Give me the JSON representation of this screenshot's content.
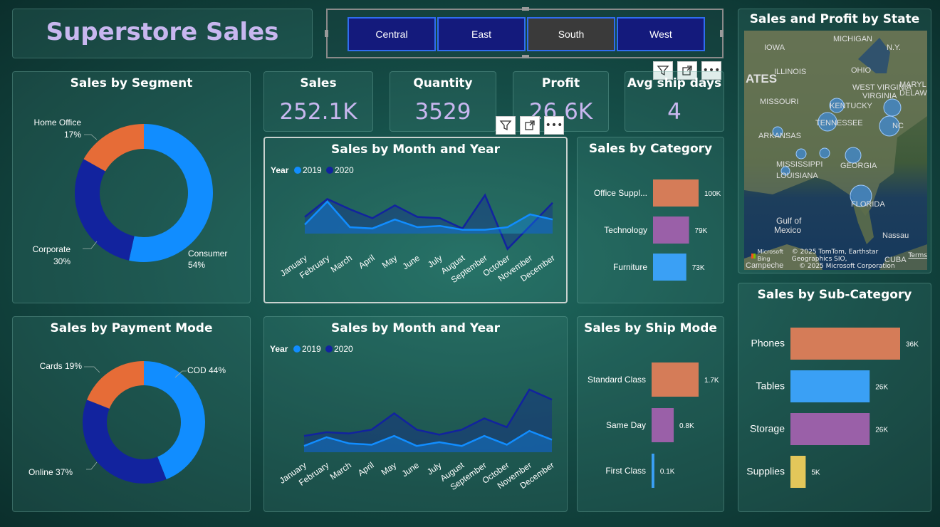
{
  "header": {
    "title": "Superstore Sales"
  },
  "region_slicer": {
    "items": [
      {
        "label": "Central",
        "selected": false
      },
      {
        "label": "East",
        "selected": false
      },
      {
        "label": "South",
        "selected": true
      },
      {
        "label": "West",
        "selected": false
      }
    ]
  },
  "kpis": [
    {
      "title": "Sales",
      "value": "252.1K"
    },
    {
      "title": "Quantity",
      "value": "3529"
    },
    {
      "title": "Profit",
      "value": "26.6K"
    },
    {
      "title": "Avg ship days",
      "value": "4"
    }
  ],
  "segment_chart": {
    "title": "Sales by Segment",
    "slices": [
      {
        "name": "Consumer",
        "pct": 54,
        "label_name": "Consumer",
        "label_pct": "54%",
        "color": "#118dff"
      },
      {
        "name": "Corporate",
        "pct": 30,
        "label_name": "Corporate",
        "label_pct": "30%",
        "color": "#12239e"
      },
      {
        "name": "Home Office",
        "pct": 17,
        "label_name": "Home Office",
        "label_pct": "17%",
        "color": "#e66c37"
      }
    ]
  },
  "payment_chart": {
    "title": "Sales by Payment Mode",
    "slices": [
      {
        "name": "COD",
        "pct": 44,
        "label": "COD 44%",
        "color": "#118dff"
      },
      {
        "name": "Online",
        "pct": 37,
        "label": "Online 37%",
        "color": "#12239e"
      },
      {
        "name": "Cards",
        "pct": 19,
        "label": "Cards 19%",
        "color": "#e66c37"
      }
    ]
  },
  "month_chart_1": {
    "title": "Sales by Month and Year",
    "legend_title": "Year",
    "series": [
      {
        "name": "2019",
        "color": "#118dff",
        "values": [
          7,
          25,
          5,
          4,
          11,
          5,
          6,
          3,
          3,
          5,
          15,
          11
        ]
      },
      {
        "name": "2020",
        "color": "#12239e",
        "values": [
          13,
          27,
          19,
          12,
          22,
          13,
          12,
          4,
          30,
          -12,
          6,
          24
        ]
      }
    ],
    "months": [
      "January",
      "February",
      "March",
      "April",
      "May",
      "June",
      "July",
      "August",
      "September",
      "October",
      "November",
      "December"
    ]
  },
  "month_chart_2": {
    "title": "Sales by Month and Year",
    "legend_title": "Year",
    "series": [
      {
        "name": "2019",
        "color": "#118dff",
        "values": [
          5,
          12,
          7,
          6,
          13,
          5,
          8,
          5,
          13,
          6,
          17,
          10
        ]
      },
      {
        "name": "2020",
        "color": "#12239e",
        "values": [
          13,
          16,
          15,
          18,
          31,
          18,
          14,
          18,
          27,
          20,
          50,
          42
        ]
      }
    ],
    "months": [
      "January",
      "February",
      "March",
      "April",
      "May",
      "June",
      "July",
      "August",
      "September",
      "October",
      "November",
      "December"
    ]
  },
  "category_chart": {
    "title": "Sales by Category",
    "bars": [
      {
        "label": "Office Suppl...",
        "value": 100,
        "value_label": "100K",
        "color": "#d57c58"
      },
      {
        "label": "Technology",
        "value": 79,
        "value_label": "79K",
        "color": "#9a60a8"
      },
      {
        "label": "Furniture",
        "value": 73,
        "value_label": "73K",
        "color": "#3aa0f5"
      }
    ]
  },
  "shipmode_chart": {
    "title": "Sales by Ship Mode",
    "bars": [
      {
        "label": "Standard Class",
        "value": 1.7,
        "value_label": "1.7K",
        "color": "#d57c58"
      },
      {
        "label": "Same Day",
        "value": 0.8,
        "value_label": "0.8K",
        "color": "#9a60a8"
      },
      {
        "label": "First Class",
        "value": 0.1,
        "value_label": "0.1K",
        "color": "#3aa0f5"
      }
    ]
  },
  "subcategory_chart": {
    "title": "Sales by Sub-Category",
    "bars": [
      {
        "label": "Phones",
        "value": 36,
        "value_label": "36K",
        "color": "#d57c58"
      },
      {
        "label": "Tables",
        "value": 26,
        "value_label": "26K",
        "color": "#3aa0f5"
      },
      {
        "label": "Storage",
        "value": 26,
        "value_label": "26K",
        "color": "#9a60a8"
      },
      {
        "label": "Supplies",
        "value": 5,
        "value_label": "5K",
        "color": "#e3c75a"
      }
    ]
  },
  "map": {
    "title": "Sales and Profit by State",
    "labels": [
      "IOWA",
      "MICHIGAN",
      "N.Y.",
      "ILLINOIS",
      "OHIO",
      "ATES",
      "MISSOURI",
      "KENTUCKY",
      "WEST VIRGINIA",
      "VIRGINIA",
      "DELAW",
      "MARYL",
      "TENNESSEE",
      "NC",
      "ARKANSAS",
      "MISSISSIPPI",
      "GEORGIA",
      "LOUISIANA",
      "FLORIDA",
      "Gulf of",
      "Mexico",
      "Nassau",
      "CUBA",
      "Campeche"
    ],
    "copyright_1": "© 2025 TomTom, Earthstar Geographics SIO,",
    "copyright_2": "© 2025 Microsoft Corporation",
    "terms": "Terms",
    "bing": "Microsoft Bing"
  }
}
